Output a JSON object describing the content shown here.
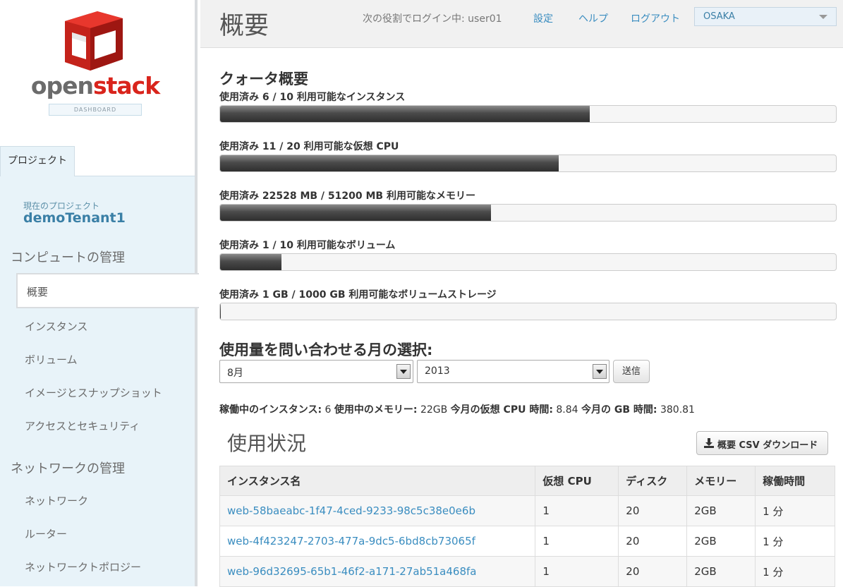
{
  "brand": {
    "logo_word_1": "open",
    "logo_word_2": "stack",
    "logo_badge": "DASHBOARD",
    "colors": {
      "red": "#d9241c",
      "gray": "#6b6b6b"
    }
  },
  "sidebar": {
    "tab": "プロジェクト",
    "current_project_label": "現在のプロジェクト",
    "current_project_name": "demoTenant1",
    "sections": [
      {
        "title": "コンピュートの管理",
        "items": [
          "概要",
          "インスタンス",
          "ボリューム",
          "イメージとスナップショット",
          "アクセスとセキュリティ"
        ],
        "active": "概要"
      },
      {
        "title": "ネットワークの管理",
        "items": [
          "ネットワーク",
          "ルーター",
          "ネットワークトポロジー"
        ]
      }
    ]
  },
  "header": {
    "title": "概要",
    "login_info": "次の役割でログイン中: user01",
    "links": [
      "設定",
      "ヘルプ",
      "ログアウト"
    ],
    "region": "OSAKA"
  },
  "quota": {
    "heading": "クォータ概要",
    "items": [
      {
        "label": "使用済み 6 / 10 利用可能なインスタンス",
        "used_fraction": 0.6
      },
      {
        "label": "使用済み 11 / 20 利用可能な仮想 CPU",
        "used_fraction": 0.55
      },
      {
        "label": "使用済み 22528 MB / 51200 MB 利用可能なメモリー",
        "used_fraction": 0.44
      },
      {
        "label": "使用済み 1 / 10 利用可能なボリューム",
        "used_fraction": 0.1
      },
      {
        "label": "使用済み 1 GB / 1000 GB 利用可能なボリュームストレージ",
        "used_fraction": 0.001
      }
    ]
  },
  "month_select": {
    "heading": "使用量を問い合わせる月の選択:",
    "month": "8月",
    "year": "2013",
    "submit": "送信"
  },
  "summary": {
    "active_instances_label": "稼働中のインスタンス:",
    "active_instances": "6",
    "memory_label": "使用中のメモリー:",
    "memory": "22GB",
    "vcpu_hours_label": "今月の仮想 CPU 時間:",
    "vcpu_hours": "8.84",
    "gb_hours_label": "今月の GB 時間:",
    "gb_hours": "380.81"
  },
  "usage": {
    "title": "使用状況",
    "csv_button": "概要 CSV ダウンロード",
    "columns": [
      "インスタンス名",
      "仮想 CPU",
      "ディスク",
      "メモリー",
      "稼働時間"
    ],
    "rows": [
      [
        "web-58baeabc-1f47-4ced-9233-98c5c38e0e6b",
        "1",
        "20",
        "2GB",
        "1 分"
      ],
      [
        "web-4f423247-2703-477a-9dc5-6bd8cb73065f",
        "1",
        "20",
        "2GB",
        "1 分"
      ],
      [
        "web-96d32695-65b1-46f2-a171-27ab51a468fa",
        "1",
        "20",
        "2GB",
        "1 分"
      ]
    ]
  }
}
